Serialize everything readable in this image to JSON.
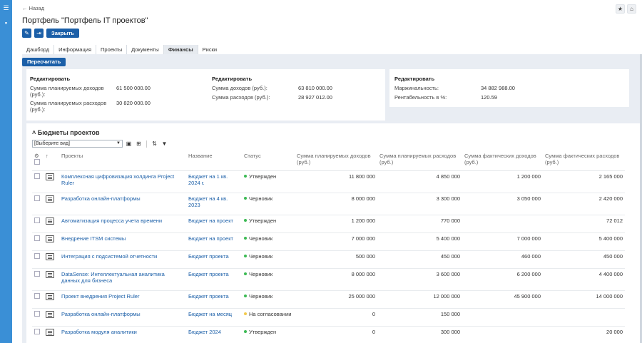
{
  "nav": {
    "back": "← Назад"
  },
  "header": {
    "title": "Портфель \"Портфель IT проектов\"",
    "close": "Закрыть"
  },
  "tabs": [
    "Дашборд",
    "Информация",
    "Проекты",
    "Документы",
    "Финансы",
    "Риски"
  ],
  "active_tab": "Финансы",
  "recalc": "Пересчитать",
  "summary": {
    "card1": {
      "edit": "Редактировать",
      "rows": [
        {
          "label": "Сумма планируемых доходов (руб.):",
          "value": "61 500 000.00"
        },
        {
          "label": "Сумма планируемых расходов (руб.):",
          "value": "30 820 000.00"
        }
      ],
      "edit2": "Редактировать",
      "rows2": [
        {
          "label": "Сумма доходов (руб.):",
          "value": "63 810 000.00"
        },
        {
          "label": "Сумма расходов (руб.):",
          "value": "28 927 012.00"
        }
      ]
    },
    "card2": {
      "edit": "Редактировать",
      "rows": [
        {
          "label": "Маржинальность:",
          "value": "34 882 988.00"
        },
        {
          "label": "Рентабельность в %:",
          "value": "120.59"
        }
      ]
    }
  },
  "budgets": {
    "title": "Бюджеты проектов",
    "view_placeholder": "[Выберите вид]",
    "columns": [
      "Проекты",
      "Название",
      "Статус",
      "Сумма планируемых доходов (руб.)",
      "Сумма планируемых расходов (руб.)",
      "Сумма фактических доходов (руб.)",
      "Сумма фактических расходов (руб.)"
    ],
    "rows": [
      {
        "project": "Комплексная цифровизация холдинга Project Ruler",
        "name": "Бюджет на 1 кв. 2024 г.",
        "status": "Утвержден",
        "status_color": "#3cba54",
        "plan_in": "11 800 000",
        "plan_out": "4 850 000",
        "fact_in": "1 200 000",
        "fact_out": "2 165 000"
      },
      {
        "project": "Разработка онлайн-платформы",
        "name": "Бюджет на 4 кв. 2023",
        "status": "Черновик",
        "status_color": "#3cba54",
        "plan_in": "8 000 000",
        "plan_out": "3 300 000",
        "fact_in": "3 050 000",
        "fact_out": "2 420 000"
      },
      {
        "project": "Автоматизация процесса учета времени",
        "name": "Бюджет на проект",
        "status": "Утвержден",
        "status_color": "#3cba54",
        "plan_in": "1 200 000",
        "plan_out": "770 000",
        "fact_in": "",
        "fact_out": "72 012"
      },
      {
        "project": "Внедрение ITSM системы",
        "name": "Бюджет на проект",
        "status": "Черновик",
        "status_color": "#3cba54",
        "plan_in": "7 000 000",
        "plan_out": "5 400 000",
        "fact_in": "7 000 000",
        "fact_out": "5 400 000"
      },
      {
        "project": "Интеграция с подсистемой отчетности",
        "name": "Бюджет проекта",
        "status": "Черновик",
        "status_color": "#3cba54",
        "plan_in": "500 000",
        "plan_out": "450 000",
        "fact_in": "460 000",
        "fact_out": "450 000"
      },
      {
        "project": "DataSense: Интеллектуальная аналитика данных для бизнеса",
        "name": "Бюджет проекта",
        "status": "Черновик",
        "status_color": "#3cba54",
        "plan_in": "8 000 000",
        "plan_out": "3 600 000",
        "fact_in": "6 200 000",
        "fact_out": "4 400 000"
      },
      {
        "project": "Проект внедрения Project Ruler",
        "name": "Бюджет проекта",
        "status": "Черновик",
        "status_color": "#3cba54",
        "plan_in": "25 000 000",
        "plan_out": "12 000 000",
        "fact_in": "45 900 000",
        "fact_out": "14 000 000"
      },
      {
        "project": "Разработка онлайн-платформы",
        "name": "Бюджет на месяц",
        "status": "На согласовании",
        "status_color": "#f2c94c",
        "plan_in": "0",
        "plan_out": "150 000",
        "fact_in": "",
        "fact_out": ""
      },
      {
        "project": "Разработка модуля аналитики",
        "name": "Бюджет 2024",
        "status": "Утвержден",
        "status_color": "#3cba54",
        "plan_in": "0",
        "plan_out": "300 000",
        "fact_in": "",
        "fact_out": "20 000"
      }
    ]
  }
}
